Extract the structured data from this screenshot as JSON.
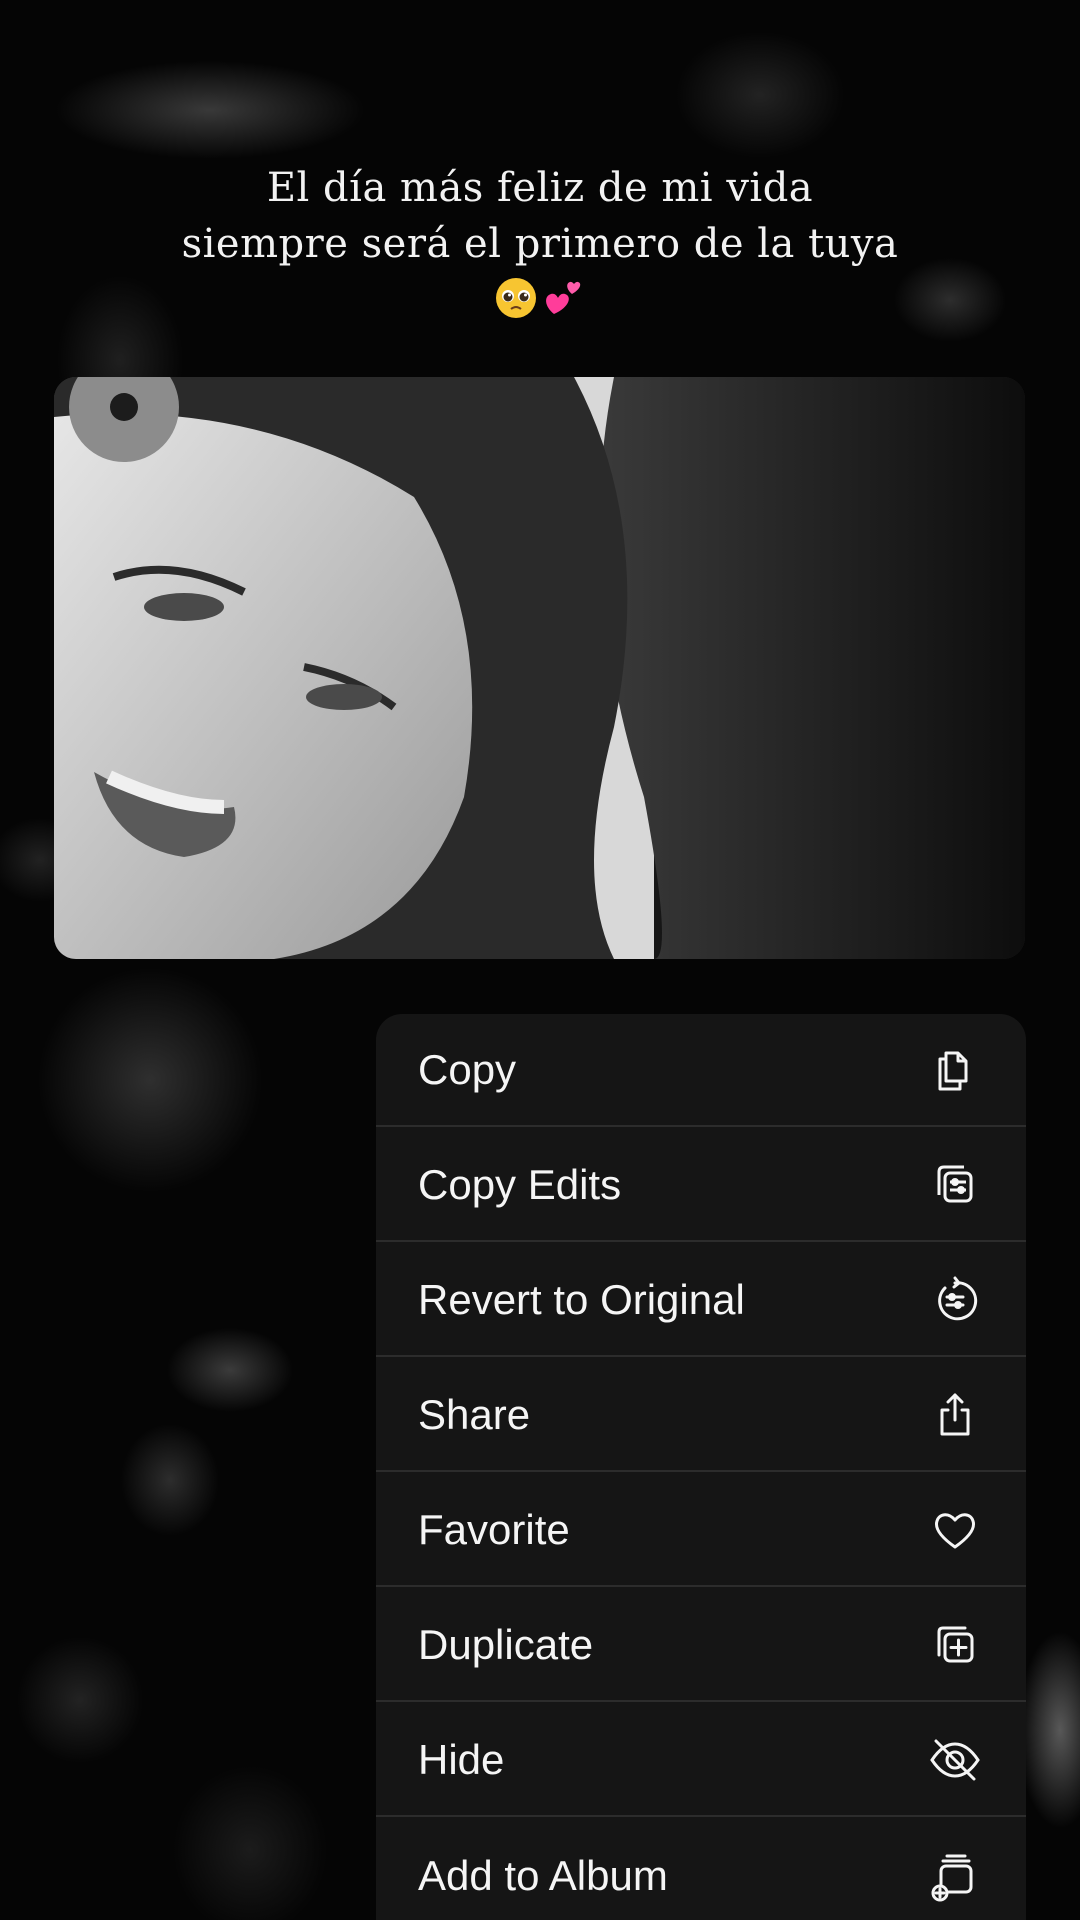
{
  "caption": {
    "line1": "El día más feliz de mi vida",
    "line2": "siempre será el primero de la tuya",
    "emojis": [
      "pleading-face",
      "two-hearts"
    ]
  },
  "photo": {
    "description_icon": "photo-preview"
  },
  "menu": {
    "items": [
      {
        "label": "Copy",
        "icon": "copy-icon"
      },
      {
        "label": "Copy Edits",
        "icon": "copy-edits-icon"
      },
      {
        "label": "Revert to Original",
        "icon": "revert-icon"
      },
      {
        "label": "Share",
        "icon": "share-icon"
      },
      {
        "label": "Favorite",
        "icon": "heart-icon"
      },
      {
        "label": "Duplicate",
        "icon": "duplicate-icon"
      },
      {
        "label": "Hide",
        "icon": "eye-slash-icon"
      },
      {
        "label": "Add to Album",
        "icon": "add-to-album-icon"
      }
    ]
  },
  "colors": {
    "background": "#050505",
    "menu_background": "#161616",
    "menu_text": "#f5f5f5",
    "divider": "#2c2c2c"
  }
}
